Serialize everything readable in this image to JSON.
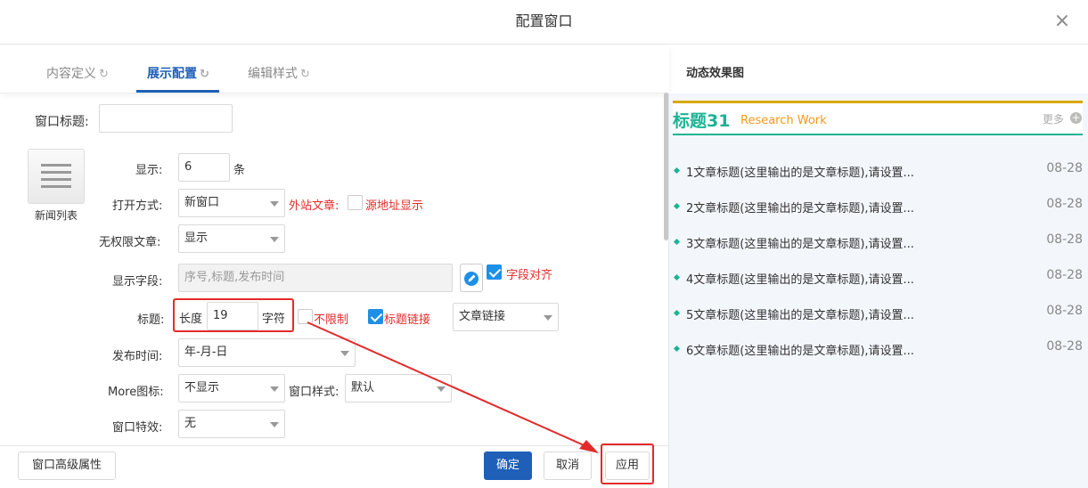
{
  "dialog": {
    "title": "配置窗口"
  },
  "tabs": [
    {
      "label": "内容定义",
      "active": false
    },
    {
      "label": "展示配置",
      "active": true
    },
    {
      "label": "编辑样式",
      "active": false
    }
  ],
  "refresh_glyph": "↻",
  "form": {
    "window_title_label": "窗口标题:",
    "window_title_value": "",
    "widget_label": "新闻列表",
    "display_label": "显示:",
    "display_value": "6",
    "display_unit": "条",
    "open_mode_label": "打开方式:",
    "open_mode_value": "新窗口",
    "external_label": "外站文章:",
    "source_display_label": "源地址显示",
    "no_perm_label": "无权限文章:",
    "no_perm_value": "显示",
    "fields_label": "显示字段:",
    "fields_value": "序号,标题,发布时间",
    "align_label": "字段对齐",
    "title_label": "标题:",
    "length_label": "长度",
    "length_value": "19",
    "chars_label": "字符",
    "unlimited_label": "不限制",
    "title_link_label": "标题链接",
    "link_type_value": "文章链接",
    "pub_time_label": "发布时间:",
    "pub_time_value": "年-月-日",
    "more_icon_label": "More图标:",
    "more_icon_value": "不显示",
    "window_style_label": "窗口样式:",
    "window_style_value": "默认",
    "effect_label": "窗口特效:",
    "effect_value": "无"
  },
  "footer": {
    "advanced": "窗口高级属性",
    "confirm": "确定",
    "cancel": "取消",
    "apply": "应用"
  },
  "preview": {
    "heading": "动态效果图",
    "title": "标题31",
    "subtitle": "Research Work",
    "more": "更多",
    "items": [
      {
        "text": "1文章标题(这里输出的是文章标题),请设置...",
        "date": "08-28"
      },
      {
        "text": "2文章标题(这里输出的是文章标题),请设置...",
        "date": "08-28"
      },
      {
        "text": "3文章标题(这里输出的是文章标题),请设置...",
        "date": "08-28"
      },
      {
        "text": "4文章标题(这里输出的是文章标题),请设置...",
        "date": "08-28"
      },
      {
        "text": "5文章标题(这里输出的是文章标题),请设置...",
        "date": "08-28"
      },
      {
        "text": "6文章标题(这里输出的是文章标题),请设置...",
        "date": "08-28"
      }
    ]
  },
  "colors": {
    "primary": "#1f5fb7",
    "accent_green": "#1bb393",
    "accent_orange": "#f39a1a",
    "red": "#e52b2b"
  }
}
